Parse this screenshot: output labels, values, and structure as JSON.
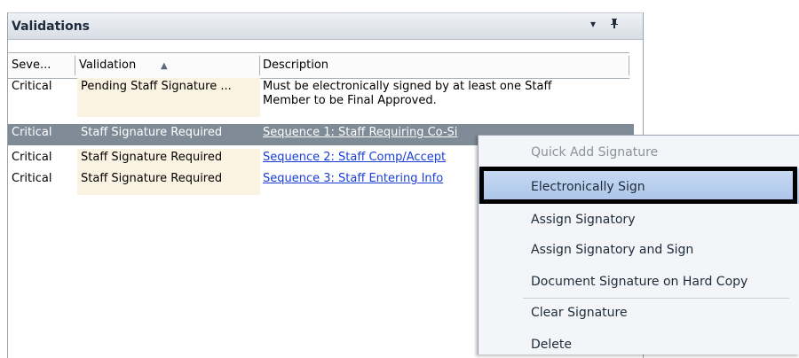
{
  "panel": {
    "title": "Validations",
    "dropdown_icon": "▾",
    "pin_icon": "ᵖ"
  },
  "columns": {
    "severity": "Seve...",
    "validation": "Validation",
    "sort_icon": "▲",
    "description": "Description"
  },
  "rows": [
    {
      "severity": "Critical",
      "validation": "Pending Staff Signature ...",
      "description_line1": "Must be electronically signed by at least one Staff",
      "description_line2": "Member to be Final Approved."
    },
    {
      "severity": "Critical",
      "validation": "Staff Signature Required",
      "description": "Sequence 1: Staff Requiring Co-Si"
    },
    {
      "severity": "Critical",
      "validation": "Staff Signature Required",
      "description": "Sequence 2: Staff Comp/Accept"
    },
    {
      "severity": "Critical",
      "validation": "Staff Signature Required",
      "description": "Sequence 3: Staff Entering Info"
    }
  ],
  "context_menu": {
    "items": [
      {
        "label": "Quick Add Signature",
        "state": "disabled"
      },
      {
        "label": "Electronically Sign",
        "state": "highlighted"
      },
      {
        "label": "Assign Signatory",
        "state": "normal"
      },
      {
        "label": "Assign Signatory and Sign",
        "state": "normal"
      },
      {
        "label": "Document Signature on Hard Copy",
        "state": "normal"
      },
      {
        "label": "Clear Signature",
        "state": "normal"
      },
      {
        "label": "Delete",
        "state": "normal"
      }
    ]
  }
}
